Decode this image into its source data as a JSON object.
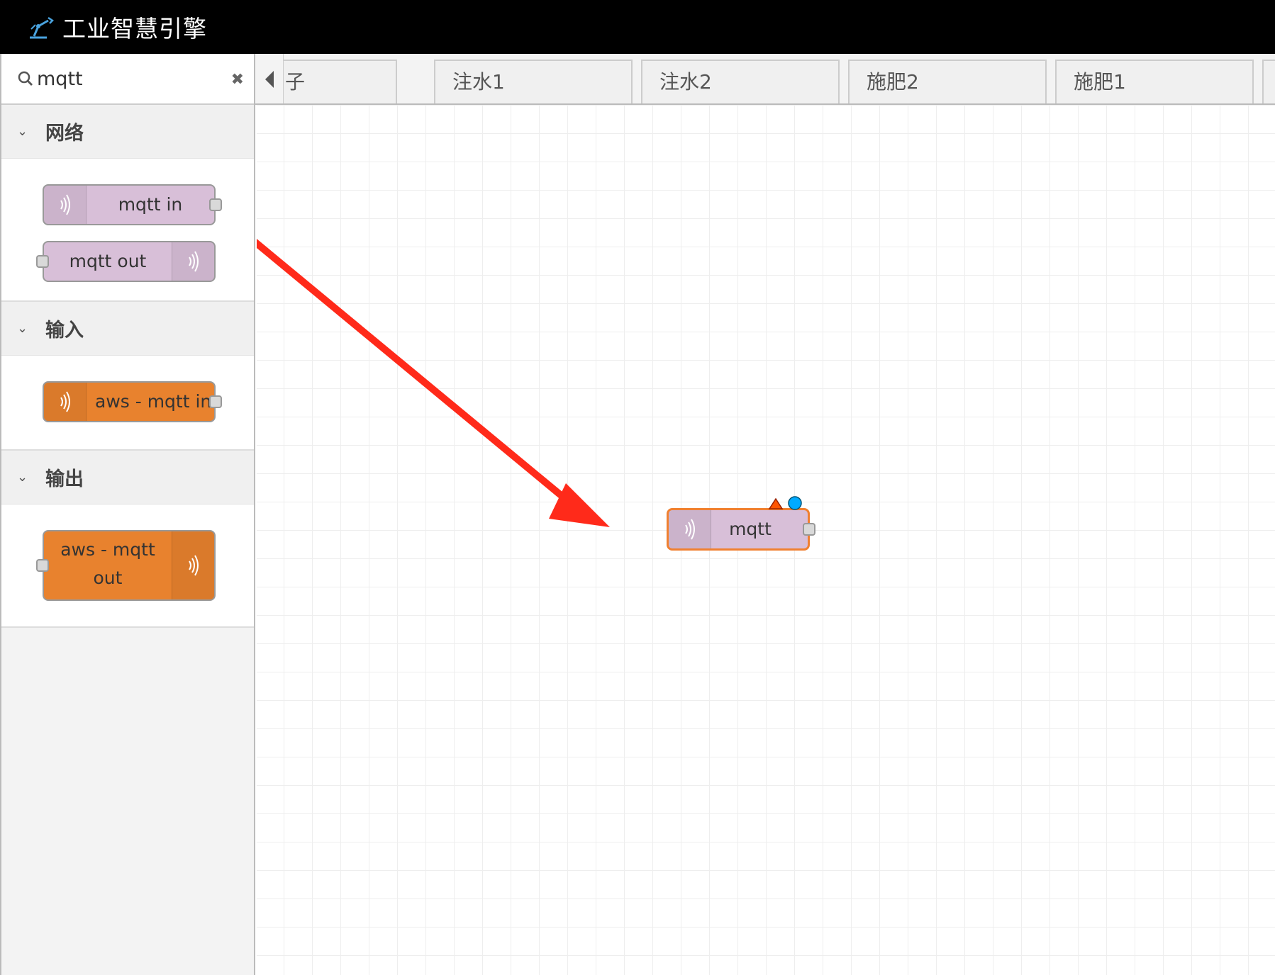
{
  "app": {
    "title": "工业智慧引擎",
    "logo_icon": "robot-arm-icon"
  },
  "palette": {
    "search": {
      "value": "mqtt",
      "icon": "search-icon",
      "clear_icon": "close-icon"
    },
    "categories": [
      {
        "label": "网络",
        "nodes": [
          {
            "label": "mqtt in",
            "color": "#d8bfd8",
            "icon": "wifi-icon"
          },
          {
            "label": "mqtt out",
            "color": "#d8bfd8",
            "icon": "wifi-icon"
          }
        ]
      },
      {
        "label": "输入",
        "nodes": [
          {
            "label": "aws - mqtt in",
            "color": "#e8822e",
            "icon": "wifi-icon"
          }
        ]
      },
      {
        "label": "输出",
        "nodes": [
          {
            "label_line1": "aws - mqtt",
            "label_line2": "out",
            "color": "#e8822e",
            "icon": "wifi-icon"
          }
        ]
      }
    ]
  },
  "tabs": [
    {
      "label": "子"
    },
    {
      "label": "注水1"
    },
    {
      "label": "注水2"
    },
    {
      "label": "施肥2"
    },
    {
      "label": "施肥1"
    }
  ],
  "workspace": {
    "node": {
      "label": "mqtt",
      "color": "#d8bfd8",
      "selected_border": "#f08030",
      "warning_color": "#ff5500",
      "changed_color": "#00aaff"
    },
    "annotation_arrow_color": "#ff2a1a"
  }
}
